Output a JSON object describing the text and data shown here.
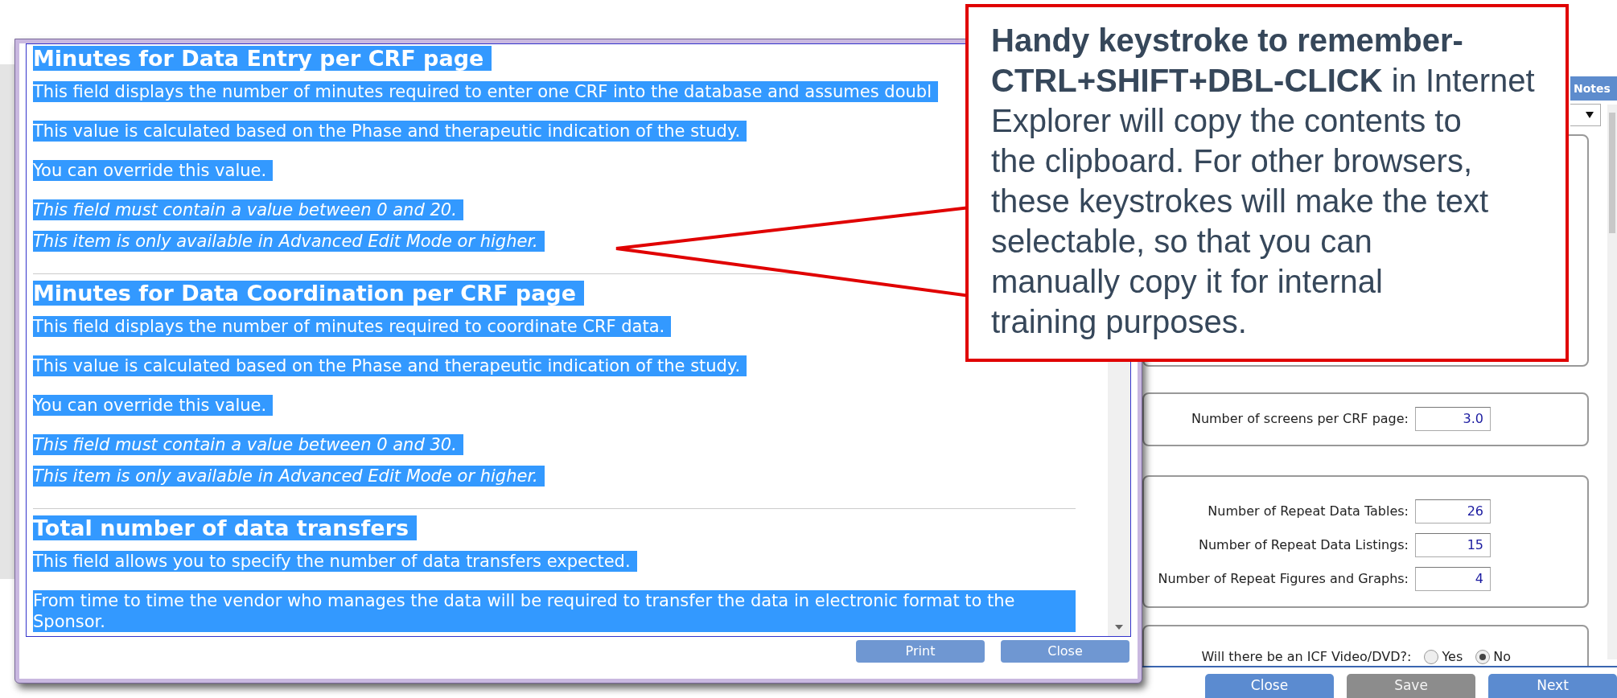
{
  "background_form": {
    "tab": "Notes",
    "groups": [
      {
        "rows": [
          {
            "kind": "number",
            "label": "Number of screens per CRF page:",
            "value": "3.0"
          }
        ]
      },
      {
        "rows": [
          {
            "kind": "number",
            "label": "Number of Repeat Data Tables:",
            "value": "26"
          },
          {
            "kind": "number",
            "label": "Number of Repeat Data Listings:",
            "value": "15"
          },
          {
            "kind": "number",
            "label": "Number of Repeat Figures and Graphs:",
            "value": "4"
          }
        ]
      },
      {
        "rows": [
          {
            "kind": "radio",
            "label": "Will there be an ICF Video/DVD?:",
            "options": [
              {
                "label": "Yes",
                "selected": false
              },
              {
                "label": "No",
                "selected": true
              }
            ]
          }
        ]
      }
    ],
    "buttons": [
      {
        "label": "Close",
        "disabled": false
      },
      {
        "label": "Save",
        "disabled": true
      },
      {
        "label": "Next",
        "disabled": false
      }
    ]
  },
  "help_dialog": {
    "sections": [
      {
        "heading": "Minutes for Data Entry per CRF page",
        "paragraphs": [
          {
            "text": "This field displays the number of minutes required to enter one CRF into the database and assumes doubl",
            "italic": false
          },
          {
            "text": "This value is calculated based on the Phase and therapeutic indication of the study.",
            "italic": false
          },
          {
            "text": "You can override this value.",
            "italic": false
          },
          {
            "text": "This field must contain a value between 0 and 20.",
            "italic": true
          },
          {
            "text": "This item is only available in Advanced Edit Mode or higher.",
            "italic": true
          }
        ]
      },
      {
        "heading": "Minutes for Data Coordination per CRF page",
        "paragraphs": [
          {
            "text": "This field displays the number of minutes required to coordinate CRF data.",
            "italic": false
          },
          {
            "text": "This value is calculated based on the Phase and therapeutic indication of the study.",
            "italic": false
          },
          {
            "text": "You can override this value.",
            "italic": false
          },
          {
            "text": "This field must contain a value between 0 and 30.",
            "italic": true
          },
          {
            "text": "This item is only available in Advanced Edit Mode or higher.",
            "italic": true
          }
        ]
      },
      {
        "heading": "Total number of data transfers",
        "paragraphs": [
          {
            "text": "This field allows you to specify the number of data transfers expected.",
            "italic": false
          },
          {
            "text": "From time to time the vendor who manages the data will be required to transfer the data in electronic format to the Sponsor.",
            "italic": false
          }
        ]
      }
    ],
    "buttons": [
      "Print",
      "Close"
    ]
  },
  "callout": {
    "text": "**Handy keystroke to remember-\nCTRL+SHIFT+DBL-CLICK** in Internet\nExplorer will copy the contents to\nthe clipboard. For other browsers,\nthese keystrokes will make the text\nselectable, so that you can\nmanually copy it for internal\ntraining purposes."
  }
}
